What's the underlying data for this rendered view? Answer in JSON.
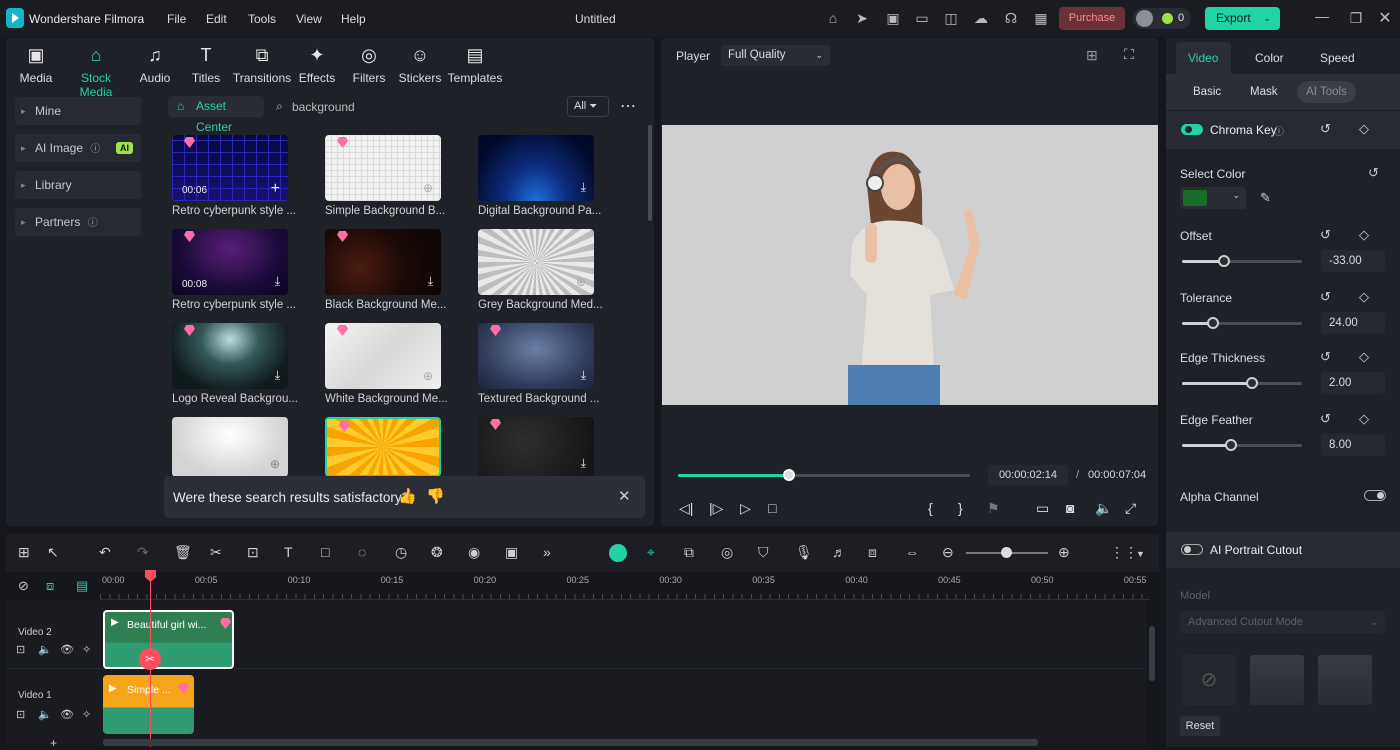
{
  "app": {
    "name": "Wondershare Filmora",
    "doc_title": "Untitled",
    "menus": [
      "File",
      "Edit",
      "Tools",
      "View",
      "Help"
    ],
    "purchase": "Purchase",
    "export": "Export",
    "credits": "0"
  },
  "media_tabs": [
    {
      "label": "Media",
      "icon": "media-icon"
    },
    {
      "label": "Stock Media",
      "icon": "stock-media-icon"
    },
    {
      "label": "Audio",
      "icon": "audio-icon"
    },
    {
      "label": "Titles",
      "icon": "titles-icon"
    },
    {
      "label": "Transitions",
      "icon": "transitions-icon"
    },
    {
      "label": "Effects",
      "icon": "effects-icon"
    },
    {
      "label": "Filters",
      "icon": "filters-icon"
    },
    {
      "label": "Stickers",
      "icon": "stickers-icon"
    },
    {
      "label": "Templates",
      "icon": "templates-icon"
    }
  ],
  "sidebar": {
    "items": [
      {
        "label": "Mine"
      },
      {
        "label": "AI Image",
        "badge": "AI"
      },
      {
        "label": "Library"
      },
      {
        "label": "Partners"
      }
    ]
  },
  "asset": {
    "center_label": "Asset Center",
    "search_value": "background",
    "filter_label": "All"
  },
  "grid": [
    {
      "label": "Retro cyberpunk style ...",
      "duration": "00:06"
    },
    {
      "label": "Simple Background B..."
    },
    {
      "label": "Digital Background Pa..."
    },
    {
      "label": "Retro cyberpunk style ...",
      "duration": "00:08"
    },
    {
      "label": "Black Background Me..."
    },
    {
      "label": "Grey Background Med..."
    },
    {
      "label": "Logo Reveal Backgrou..."
    },
    {
      "label": "White Background Me..."
    },
    {
      "label": "Textured Background ..."
    }
  ],
  "feedback": {
    "question": "Were these search results satisfactory?"
  },
  "player": {
    "label": "Player",
    "quality": "Full Quality",
    "current_time": "00:00:02:14",
    "separator": "/",
    "total_time": "00:00:07:04",
    "progress": 0.38
  },
  "right_panel": {
    "tabs": [
      "Video",
      "Color",
      "Speed"
    ],
    "subtabs": [
      "Basic",
      "Mask",
      "AI Tools"
    ],
    "chroma_key": "Chroma Key",
    "select_color": "Select Color",
    "color_swatch": "#1a6b2a",
    "params": [
      {
        "label": "Offset",
        "value": "-33.00",
        "level": 0.35
      },
      {
        "label": "Tolerance",
        "value": "24.00",
        "level": 0.26
      },
      {
        "label": "Edge Thickness",
        "value": "2.00",
        "level": 0.58
      },
      {
        "label": "Edge Feather",
        "value": "8.00",
        "level": 0.41
      }
    ],
    "alpha_channel": "Alpha Channel",
    "ai_portrait": "AI Portrait Cutout",
    "model_label": "Model",
    "model_value": "Advanced Cutout Mode",
    "reset": "Reset"
  },
  "timeline": {
    "ruler": [
      "00:00",
      "00:05",
      "00:10",
      "00:15",
      "00:20",
      "00:25",
      "00:30",
      "00:35",
      "00:40",
      "00:45",
      "00:50",
      "00:55"
    ],
    "tracks": [
      {
        "label": "Video 2",
        "clip": "Beautiful girl wi..."
      },
      {
        "label": "Video 1",
        "clip": "Simple ..."
      }
    ]
  }
}
